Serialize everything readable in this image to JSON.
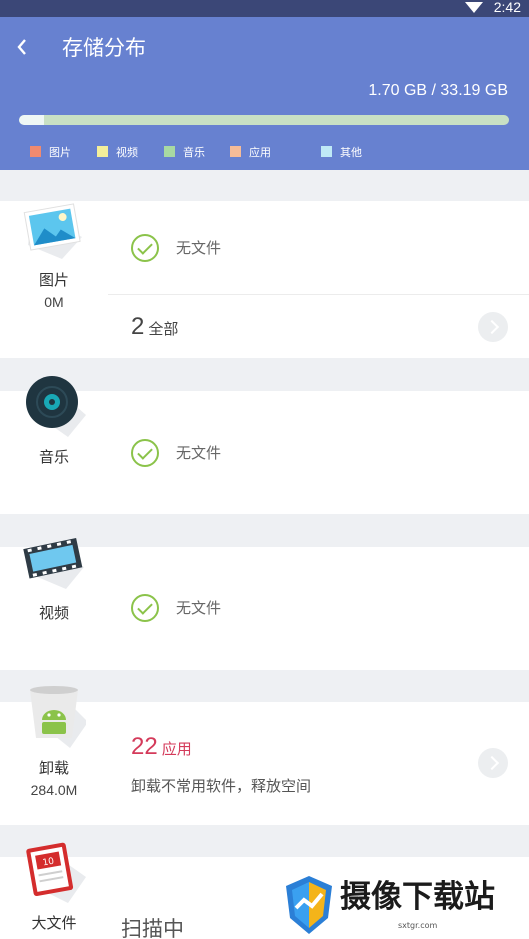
{
  "status_bar": {
    "time": "2:42"
  },
  "header": {
    "title": "存储分布",
    "usage": "1.70 GB / 33.19 GB",
    "used_fraction": 0.051,
    "legend": [
      {
        "label": "图片",
        "color": "#f08a6f"
      },
      {
        "label": "视频",
        "color": "#f4ef9a"
      },
      {
        "label": "音乐",
        "color": "#a8d9a2"
      },
      {
        "label": "应用",
        "color": "#f5bc98"
      },
      {
        "label": "其他",
        "color": "#bfe9f6"
      }
    ]
  },
  "sections": {
    "pictures": {
      "label": "图片",
      "size": "0M",
      "status": "无文件",
      "count": "2",
      "count_unit": "全部"
    },
    "music": {
      "label": "音乐",
      "status": "无文件"
    },
    "videos": {
      "label": "视频",
      "status": "无文件"
    },
    "uninstall": {
      "label": "卸载",
      "size": "284.0M",
      "count": "22",
      "count_unit": "应用",
      "description": "卸载不常用软件，释放空间",
      "accent_color": "#d43a5a"
    },
    "large_files": {
      "label": "大文件",
      "status": "扫描中"
    }
  },
  "watermark": {
    "text": "摄像下载站",
    "sub": "sxtgr.com"
  }
}
